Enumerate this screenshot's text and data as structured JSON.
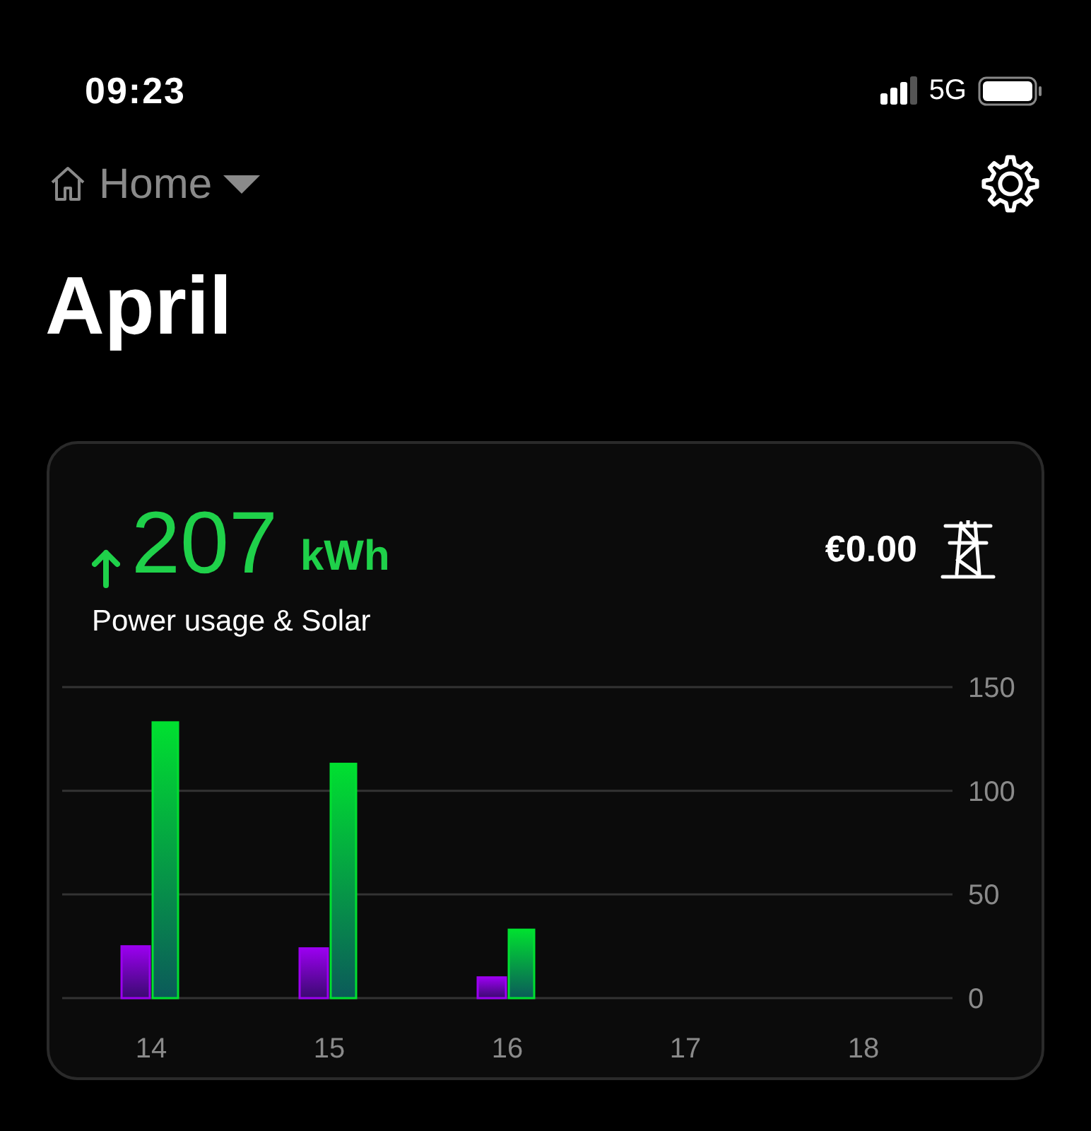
{
  "status_bar": {
    "time": "09:23",
    "network": "5G"
  },
  "header": {
    "location": "Home"
  },
  "title": "April",
  "card": {
    "total": "207",
    "unit": "kWh",
    "subtitle": "Power usage & Solar",
    "cost": "€0.00",
    "chart_data": {
      "type": "bar",
      "categories": [
        "14",
        "15",
        "16",
        "17",
        "18"
      ],
      "series": [
        {
          "color": "#9b00f0",
          "values": [
            25,
            24,
            10,
            null,
            null
          ]
        },
        {
          "color": "#00e030",
          "values": [
            133,
            113,
            33,
            null,
            null
          ]
        }
      ],
      "ylim": [
        0,
        150
      ],
      "yticks": [
        0,
        50,
        100,
        150
      ]
    }
  }
}
